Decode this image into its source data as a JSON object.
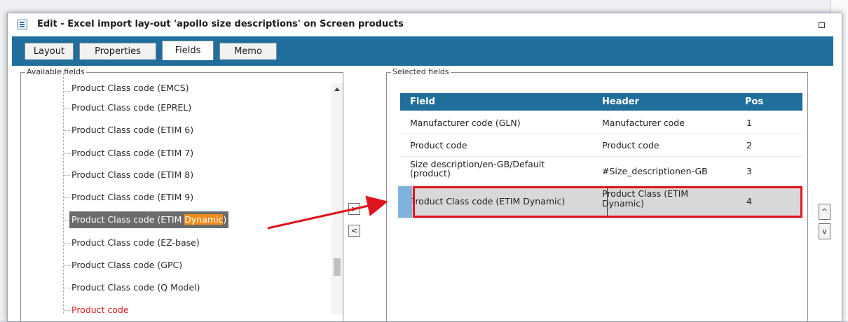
{
  "dialog": {
    "title": "Edit - Excel import lay-out 'apollo size descriptions' on Screen products"
  },
  "tabs": [
    {
      "label": "Layout",
      "active": false
    },
    {
      "label": "Properties",
      "active": false
    },
    {
      "label": "Fields",
      "active": true
    },
    {
      "label": "Memo",
      "active": false
    }
  ],
  "available_fields": {
    "legend": "Available fields",
    "items": [
      "Product Class code (EMCS)",
      "Product Class code (EPREL)",
      "Product Class code (ETIM 6)",
      "Product Class code (ETIM 7)",
      "Product Class code (ETIM 8)",
      "Product Class code (ETIM 9)",
      "Product Class code (ETIM Dynamic)",
      "Product Class code (EZ-base)",
      "Product Class code (GPC)",
      "Product Class code (Q Model)",
      "Product code"
    ],
    "selected_item": {
      "before": "Product Class code (ETIM ",
      "highlight": "Dynamic",
      "after": ")"
    }
  },
  "transfer_buttons": {
    "add": ">",
    "remove": "<"
  },
  "selected_fields": {
    "legend": "Selected fields",
    "columns": {
      "field": "Field",
      "header": "Header",
      "pos": "Pos"
    },
    "rows": [
      {
        "field": "Manufacturer code (GLN)",
        "header": "Manufacturer code",
        "pos": "1"
      },
      {
        "field": "Product code",
        "header": "Product code",
        "pos": "2"
      },
      {
        "field": "Size description/en-GB/Default (product)",
        "header": "#Size_descriptionen-GB",
        "pos": "3"
      },
      {
        "field": "Product Class code (ETIM Dynamic)",
        "header": "Product Class (ETIM Dynamic)",
        "pos": "4"
      }
    ]
  },
  "order_buttons": {
    "up": "^",
    "down": "v"
  },
  "colors": {
    "accent": "#1f6e9c",
    "highlight": "#f08c1a",
    "annotation": "#e0141c",
    "selected_tree": "#6b6b6b"
  }
}
